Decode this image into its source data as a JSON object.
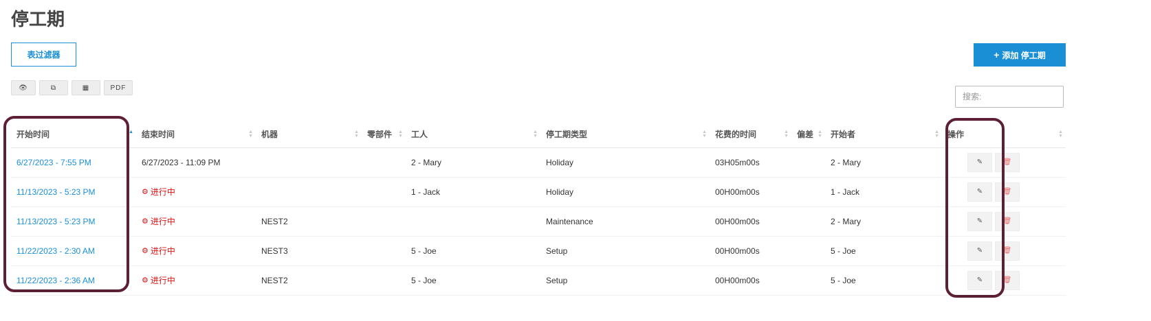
{
  "page": {
    "title": "停工期"
  },
  "toolbar": {
    "filter_label": "表过滤器",
    "add_label": "添加 停工期",
    "add_icon": "plus-icon"
  },
  "export_buttons": [
    {
      "icon": "eye-icon",
      "label": "👁"
    },
    {
      "icon": "copy-icon",
      "label": "⧉"
    },
    {
      "icon": "table-icon",
      "label": "▦"
    },
    {
      "icon": "pdf-icon",
      "label": "PDF"
    }
  ],
  "search": {
    "placeholder": "搜索:",
    "value": ""
  },
  "table": {
    "headers": [
      "开始时间",
      "结束时间",
      "机器",
      "零部件",
      "工人",
      "停工期类型",
      "花费的时间",
      "偏差",
      "开始者",
      "操作"
    ],
    "sorted_column": "开始时间",
    "rows": [
      {
        "start": "6/27/2023 - 7:55 PM",
        "end": "6/27/2023 - 11:09 PM",
        "running": false,
        "machine": "",
        "part": "",
        "worker": "2 - Mary",
        "type": "Holiday",
        "duration": "03H05m00s",
        "deviation": "",
        "starter": "2 - Mary"
      },
      {
        "start": "11/13/2023 - 5:23 PM",
        "end": "进行中",
        "running": true,
        "machine": "",
        "part": "",
        "worker": "1 - Jack",
        "type": "Holiday",
        "duration": "00H00m00s",
        "deviation": "",
        "starter": "1 - Jack"
      },
      {
        "start": "11/13/2023 - 5:23 PM",
        "end": "进行中",
        "running": true,
        "machine": "NEST2",
        "part": "",
        "worker": "",
        "type": "Maintenance",
        "duration": "00H00m00s",
        "deviation": "",
        "starter": "2 - Mary"
      },
      {
        "start": "11/22/2023 - 2:30 AM",
        "end": "进行中",
        "running": true,
        "machine": "NEST3",
        "part": "",
        "worker": "5 - Joe",
        "type": "Setup",
        "duration": "00H00m00s",
        "deviation": "",
        "starter": "5 - Joe"
      },
      {
        "start": "11/22/2023 - 2:36 AM",
        "end": "进行中",
        "running": true,
        "machine": "NEST2",
        "part": "",
        "worker": "5 - Joe",
        "type": "Setup",
        "duration": "00H00m00s",
        "deviation": "",
        "starter": "5 - Joe"
      }
    ]
  },
  "row_actions": {
    "edit_icon": "edit-icon",
    "edit_glyph": "✎",
    "delete_icon": "trash-icon",
    "delete_glyph": "🗑",
    "running_icon": "gears-icon",
    "running_glyph": "⚙"
  },
  "colors": {
    "accent": "#1a8fd6",
    "running": "#dd1111",
    "highlight": "#5c1f35"
  }
}
